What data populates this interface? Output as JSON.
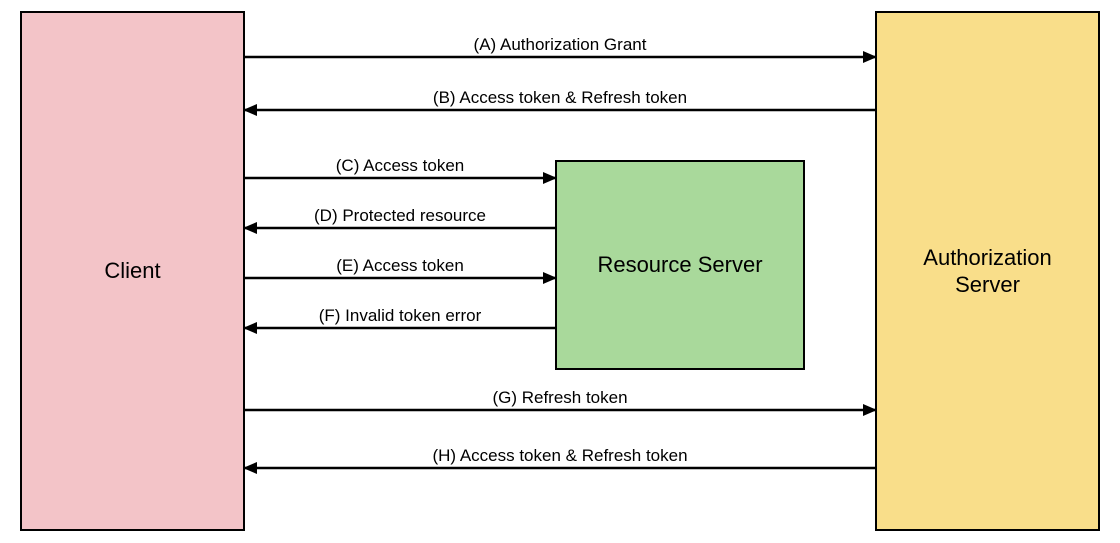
{
  "nodes": {
    "client": {
      "label": "Client",
      "fill": "#F3C4C8"
    },
    "resource_server": {
      "label": "Resource Server",
      "fill": "#A9D99B"
    },
    "auth_server": {
      "label": "Authorization\nServer",
      "fill": "#F9DE8A"
    }
  },
  "arrows": {
    "a": "(A) Authorization Grant",
    "b": "(B) Access token & Refresh token",
    "c": "(C) Access token",
    "d": "(D) Protected resource",
    "e": "(E) Access token",
    "f": "(F) Invalid token error",
    "g": "(G) Refresh token",
    "h": "(H) Access token & Refresh token"
  }
}
